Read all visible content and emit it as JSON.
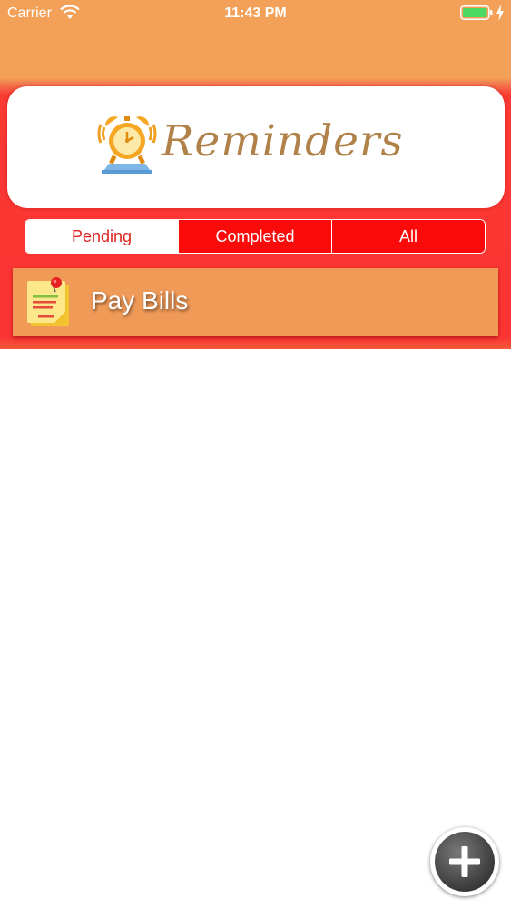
{
  "status_bar": {
    "carrier": "Carrier",
    "time": "11:43 PM",
    "icons": [
      "wifi-icon",
      "battery-icon",
      "charging-icon"
    ]
  },
  "header": {
    "logo_text": "Reminders",
    "logo_icon": "alarm-clock-icon"
  },
  "tabs": [
    {
      "label": "Pending",
      "selected": true
    },
    {
      "label": "Completed",
      "selected": false
    },
    {
      "label": "All",
      "selected": false
    }
  ],
  "reminders": [
    {
      "title": "Pay Bills",
      "icon": "sticky-note-icon"
    }
  ],
  "fab": {
    "icon": "plus-icon"
  },
  "colors": {
    "header_orange": "#F3A058",
    "header_red": "#FB3333",
    "segment_red": "#FB0A0A",
    "item_orange": "#F09A58",
    "logo_gold": "#B0824A"
  }
}
